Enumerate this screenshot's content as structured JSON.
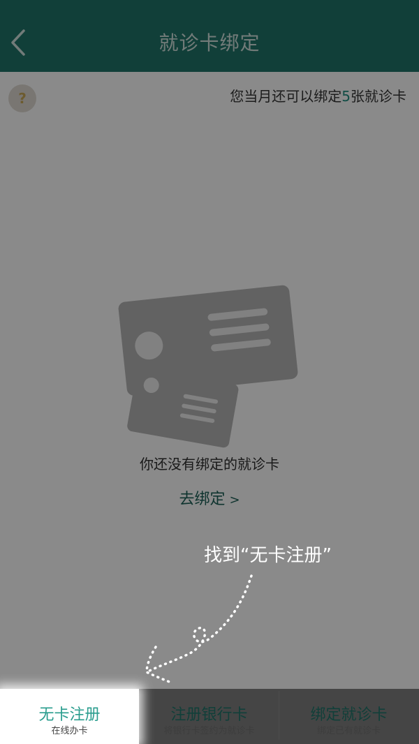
{
  "header": {
    "title": "就诊卡绑定",
    "back_icon": "chevron-left-icon"
  },
  "help": {
    "icon": "question-icon",
    "glyph": "?"
  },
  "quota": {
    "prefix": "您当月还可以绑定",
    "count": "5",
    "suffix": "张就诊卡"
  },
  "empty_state": {
    "illustration": "cards-illustration",
    "message": "你还没有绑定的就诊卡",
    "link_label": "去绑定",
    "link_arrow": ">"
  },
  "hint": {
    "text": "找到“无卡注册”"
  },
  "tabs": [
    {
      "label": "无卡注册",
      "sublabel": "在线办卡"
    },
    {
      "label": "注册银行卡",
      "sublabel": "将银行卡签约为就诊卡"
    },
    {
      "label": "绑定就诊卡",
      "sublabel": "绑定已有就诊卡"
    }
  ],
  "colors": {
    "header_bg": "#1f7468",
    "accent": "#2a9d8e",
    "overlay": "rgba(0,0,0,0.45)"
  }
}
